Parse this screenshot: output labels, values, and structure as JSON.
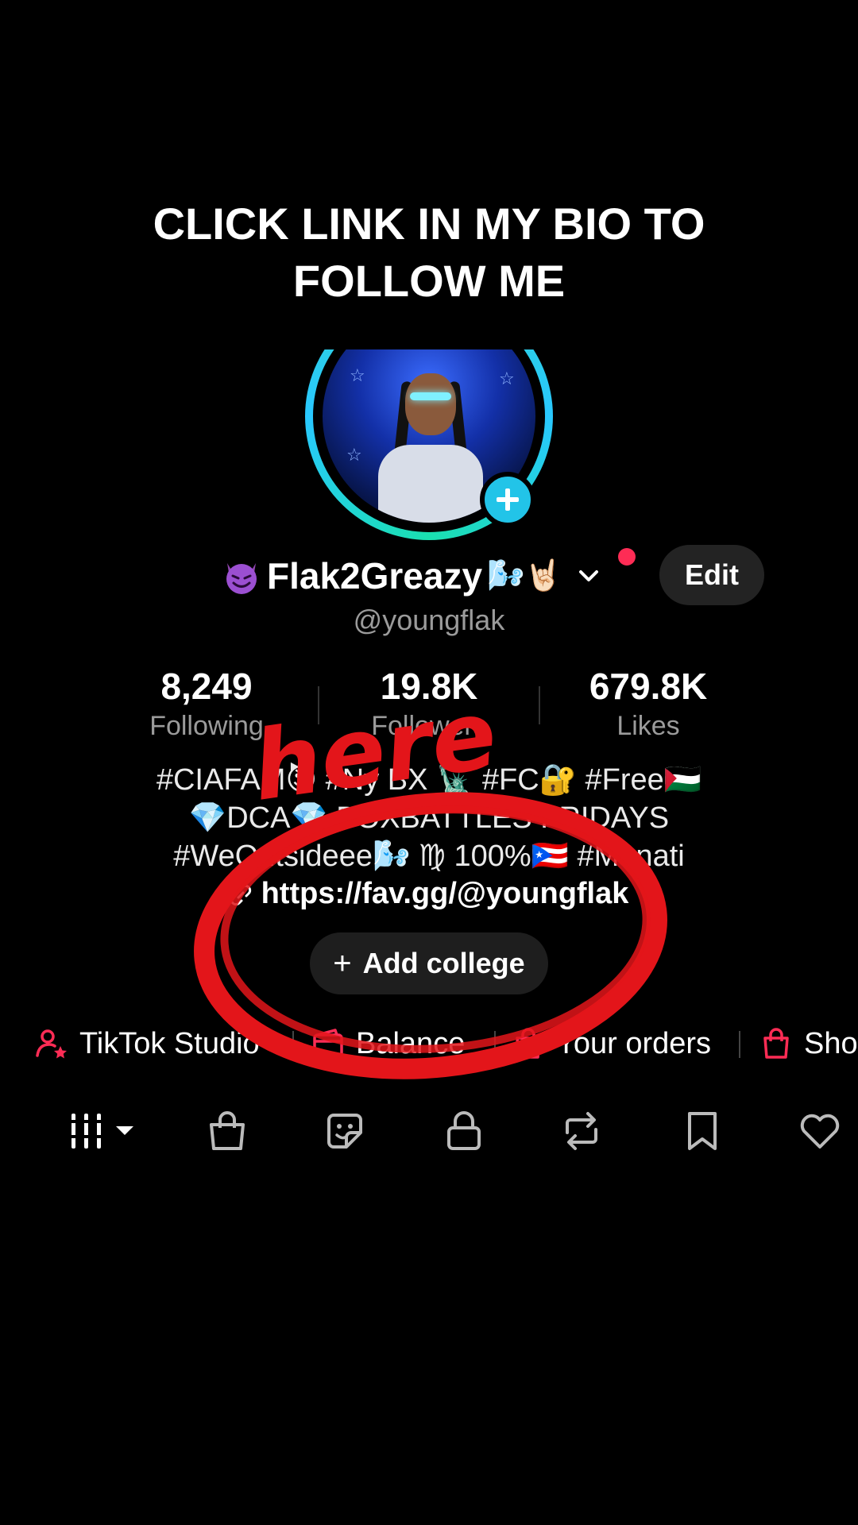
{
  "caption": {
    "line1": "CLICK LINK IN MY BIO TO",
    "line2": "FOLLOW ME"
  },
  "profile": {
    "display_name": "Flak2Greazy",
    "name_emoji": "🌬️🤘🏻",
    "handle": "@youngflak",
    "edit_label": "Edit"
  },
  "stats": [
    {
      "value": "8,249",
      "label": "Following"
    },
    {
      "value": "19.8K",
      "label": "Followers"
    },
    {
      "value": "679.8K",
      "label": "Likes"
    }
  ],
  "bio": {
    "line1": "#CIAFAM😈 #Ny BX 🗽 #FC🔐 #Free🇵🇸",
    "line2": "💎DCA💎 BOXBATTLES FRIDAYS",
    "line3": "#WeOutsideee🌬️ ♍ 100%🇵🇷 #Manati",
    "link": "https://fav.gg/@youngflak"
  },
  "college_button": "Add college",
  "tools": [
    "TikTok Studio",
    "Balance",
    "Your orders",
    "Shop"
  ],
  "annotation_text": "here",
  "tab_icons": [
    "grid-icon",
    "shopping-bag-icon",
    "sticker-icon",
    "lock-icon",
    "repost-icon",
    "bookmark-icon",
    "heart-icon"
  ],
  "colors": {
    "accent_red": "#fe2c55",
    "ring_teal": "#2fd6c9",
    "plus_badge": "#22c4e8",
    "annotation_red": "#e3151a"
  }
}
